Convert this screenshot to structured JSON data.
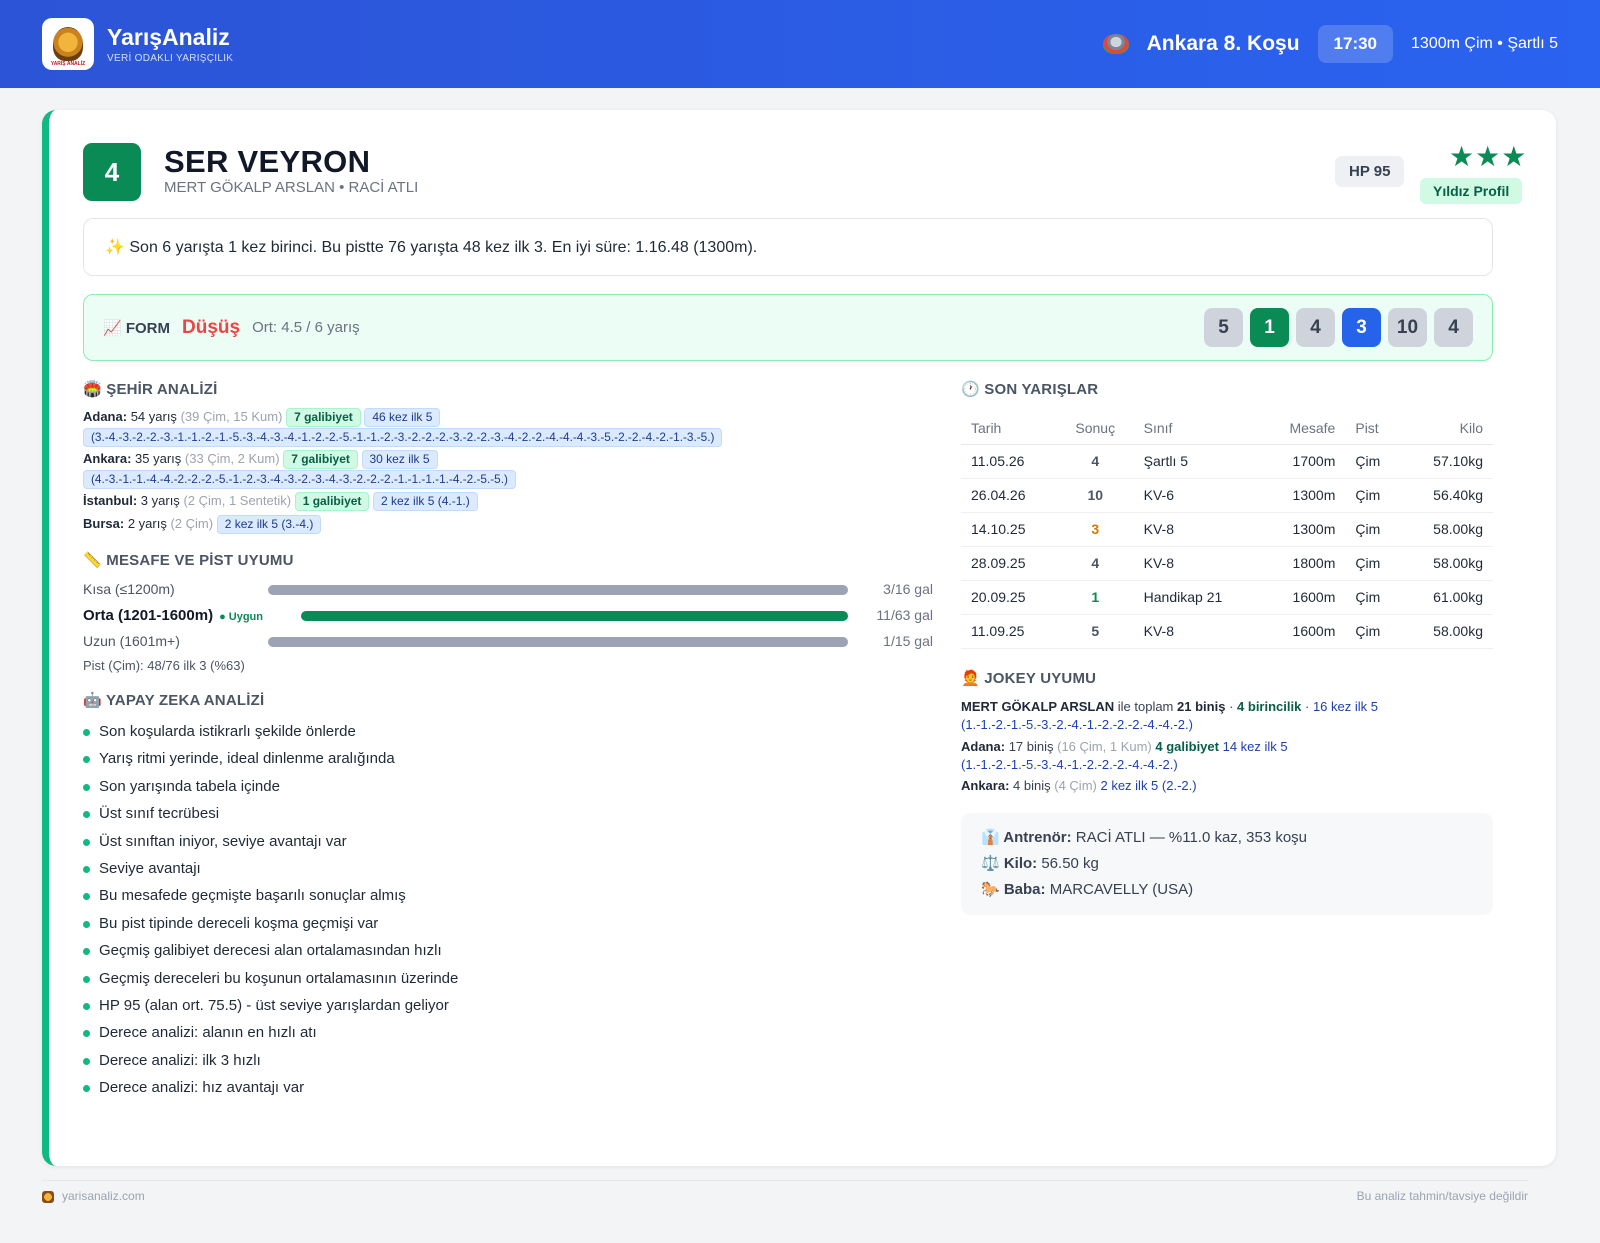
{
  "header": {
    "brand": "YarışAnaliz",
    "tagline": "VERİ ODAKLI YARIŞÇILIK",
    "logo_text": "YARIŞ ANALİZ",
    "race": "Ankara 8. Koşu",
    "time": "17:30",
    "conditions": "1300m Çim • Şartlı 5"
  },
  "horse": {
    "number": "4",
    "name": "SER VEYRON",
    "sub": "MERT GÖKALP ARSLAN • RACİ ATLI",
    "hp": "HP 95",
    "stars": "★★★",
    "badge": "Yıldız Profil",
    "summary": "✨ Son 6 yarışta 1 kez birinci. Bu pistte 76 yarışta 48 kez ilk 3. En iyi süre: 1.16.48 (1300m)."
  },
  "form": {
    "label": "📈 FORM",
    "trend": "Düşüş",
    "avg": "Ort: 4.5 / 6 yarış",
    "results": [
      "5",
      "1",
      "4",
      "3",
      "10",
      "4"
    ]
  },
  "city": {
    "title": "🏟️ ŞEHİR ANALİZİ",
    "rows": [
      {
        "name": "Adana:",
        "count": "54 yarış",
        "detail": "(39 Çim, 15 Kum)",
        "win": "7 galibiyet",
        "top5": "46 kez ilk 5",
        "seq": "(3.-4.-3.-2.-2.-3.-1.-1.-2.-1.-5.-3.-4.-3.-4.-1.-2.-2.-5.-1.-1.-2.-3.-2.-2.-2.-3.-2.-2.-3.-4.-2.-2.-4.-4.-4.-3.-5.-2.-2.-4.-2.-1.-3.-5.)"
      },
      {
        "name": "Ankara:",
        "count": "35 yarış",
        "detail": "(33 Çim, 2 Kum)",
        "win": "7 galibiyet",
        "top5": "30 kez ilk 5",
        "seq": "(4.-3.-1.-1.-4.-4.-2.-2.-2.-5.-1.-2.-3.-4.-3.-2.-3.-4.-3.-2.-2.-2.-1.-1.-1.-1.-4.-2.-5.-5.)"
      },
      {
        "name": "İstanbul:",
        "count": "3 yarış",
        "detail": "(2 Çim, 1 Sentetik)",
        "win": "1 galibiyet",
        "top5": "2 kez ilk 5 (4.-1.)"
      },
      {
        "name": "Bursa:",
        "count": "2 yarış",
        "detail": "(2 Çim)",
        "top5": "2 kez ilk 5 (3.-4.)"
      }
    ]
  },
  "distance": {
    "title": "📏 MESAFE VE PİST UYUMU",
    "ok_label": "Uygun",
    "rows": [
      {
        "label": "Kısa (≤1200m)",
        "value": "3/16 gal",
        "ratio": 0.1875
      },
      {
        "label": "Orta (1201-1600m)",
        "value": "11/63 gal",
        "ratio": 0.1746
      },
      {
        "label": "Uzun (1601m+)",
        "value": "1/15 gal",
        "ratio": 0.0667
      }
    ],
    "pist": "Pist (Çim): 48/76 ilk 3 (%63)"
  },
  "ai": {
    "title": "🤖 YAPAY ZEKA ANALİZİ",
    "items": [
      "Son koşularda istikrarlı şekilde önlerde",
      "Yarış ritmi yerinde, ideal dinlenme aralığında",
      "Son yarışında tabela içinde",
      "Üst sınıf tecrübesi",
      "Üst sınıftan iniyor, seviye avantajı var",
      "Seviye avantajı",
      "Bu mesafede geçmişte başarılı sonuçlar almış",
      "Bu pist tipinde dereceli koşma geçmişi var",
      "Geçmiş galibiyet derecesi alan ortalamasından hızlı",
      "Geçmiş dereceleri bu koşunun ortalamasının üzerinde",
      "HP 95 (alan ort. 75.5) - üst seviye yarışlardan geliyor",
      "Derece analizi: alanın en hızlı atı",
      "Derece analizi: ilk 3 hızlı",
      "Derece analizi: hız avantajı var"
    ]
  },
  "races": {
    "title": "🕐 SON YARIŞLAR",
    "headers": [
      "Tarih",
      "Sonuç",
      "Sınıf",
      "Mesafe",
      "Pist",
      "Kilo"
    ],
    "rows": [
      [
        "11.05.26",
        "4",
        "Şartlı 5",
        "1700m",
        "Çim",
        "57.10kg"
      ],
      [
        "26.04.26",
        "10",
        "KV-6",
        "1300m",
        "Çim",
        "56.40kg"
      ],
      [
        "14.10.25",
        "3",
        "KV-8",
        "1300m",
        "Çim",
        "58.00kg"
      ],
      [
        "28.09.25",
        "4",
        "KV-8",
        "1800m",
        "Çim",
        "58.00kg"
      ],
      [
        "20.09.25",
        "1",
        "Handikap 21",
        "1600m",
        "Çim",
        "61.00kg"
      ],
      [
        "11.09.25",
        "5",
        "KV-8",
        "1600m",
        "Çim",
        "58.00kg"
      ]
    ]
  },
  "jockey": {
    "title": "🧑‍🦰 JOKEY UYUMU",
    "name": "MERT GÖKALP ARSLAN",
    "mid": "ile toplam",
    "total": "21 biniş",
    "sep": "·",
    "wins": "4 birincilik",
    "top5": "16 kez ilk 5",
    "seq": "(1.-1.-2.-1.-5.-3.-2.-4.-1.-2.-2.-2.-4.-4.-2.)",
    "cities": [
      {
        "name": "Adana:",
        "count": "17 biniş",
        "detail": "(16 Çim, 1 Kum)",
        "win": "4 galibiyet",
        "top5": "14 kez ilk 5",
        "seq": "(1.-1.-2.-1.-5.-3.-4.-1.-2.-2.-2.-4.-4.-2.)"
      },
      {
        "name": "Ankara:",
        "count": "4 biniş",
        "detail": "(4 Çim)",
        "top5": "2 kez ilk 5 (2.-2.)"
      }
    ]
  },
  "info": {
    "trainer_label": "👔 Antrenör:",
    "trainer": "RACİ ATLI — %11.0 kaz, 353 koşu",
    "weight_label": "⚖️ Kilo:",
    "weight": "56.50 kg",
    "sire_label": "🐎 Baba:",
    "sire": "MARCAVELLY (USA)"
  },
  "footer": {
    "site": "yarisanaliz.com",
    "disclaimer": "Bu analiz tahmin/tavsiye değildir"
  },
  "colors": {
    "header": "#2a5ee8",
    "green": "#0a8a55",
    "accent_left": "#10b981",
    "trend_down": "#ef4444",
    "blue_pill": "#2563eb"
  }
}
